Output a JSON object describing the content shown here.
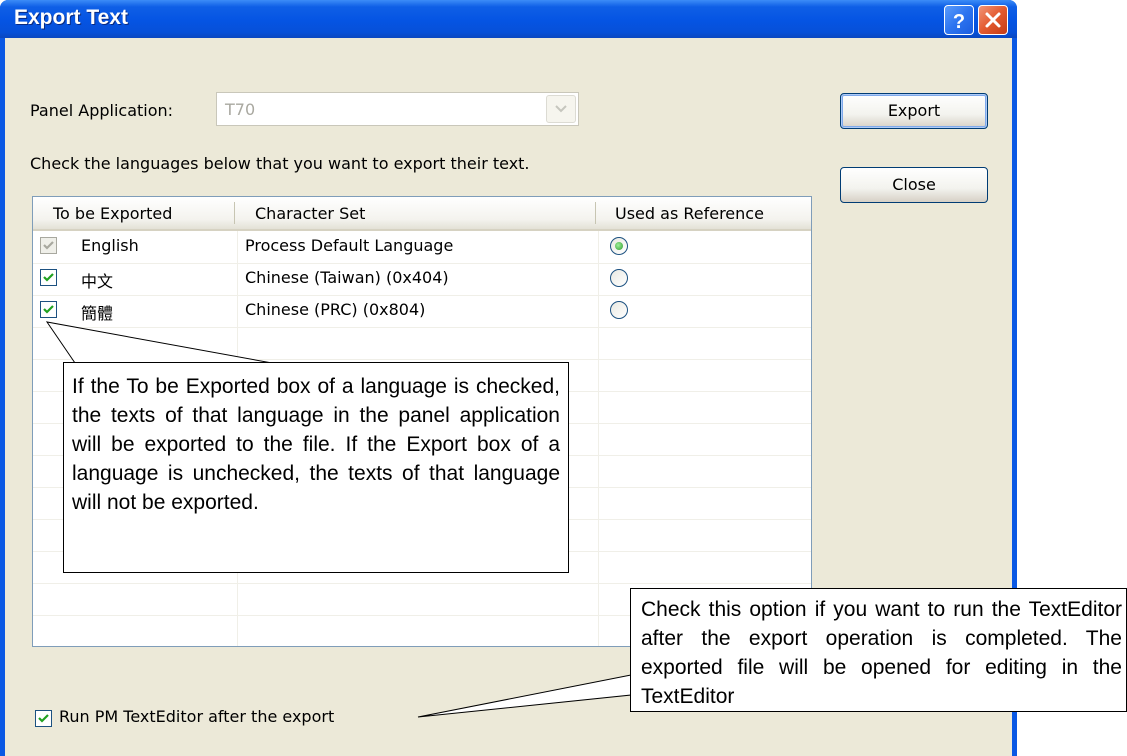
{
  "window": {
    "title": "Export Text"
  },
  "panel_application": {
    "label": "Panel Application:",
    "value": "T70"
  },
  "instruction": "Check the languages below that you want to export their text.",
  "buttons": {
    "export": "Export",
    "close": "Close"
  },
  "table": {
    "columns": [
      "To be Exported",
      "Character Set",
      "Used as Reference"
    ],
    "rows": [
      {
        "language": "English",
        "charset": "Process Default Language",
        "exported": true,
        "export_enabled": false,
        "reference": true
      },
      {
        "language": "中文",
        "charset": "Chinese (Taiwan) (0x404)",
        "exported": true,
        "export_enabled": true,
        "reference": false
      },
      {
        "language": "簡體",
        "charset": "Chinese (PRC) (0x804)",
        "exported": true,
        "export_enabled": true,
        "reference": false
      }
    ]
  },
  "run_editor": {
    "label": "Run PM TextEditor after the export",
    "checked": true
  },
  "callouts": {
    "export_box": "If the To be Exported box of a language is checked, the texts of that language in the panel application will be exported to the file. If the Export box of a language is unchecked, the texts of that language will not be exported.",
    "run_editor": "Check this option if you want to run the TextEditor after the export operation is completed. The exported file will be opened for editing in the TextEditor"
  },
  "colors": {
    "titlebar": "#0554e3",
    "dialog_face": "#ece9d8",
    "list_border": "#7f9db9",
    "check_green": "#21a121"
  },
  "icons": {
    "help": "help-icon",
    "close": "close-icon",
    "dropdown": "chevron-down-icon",
    "checkmark": "checkmark-icon"
  }
}
